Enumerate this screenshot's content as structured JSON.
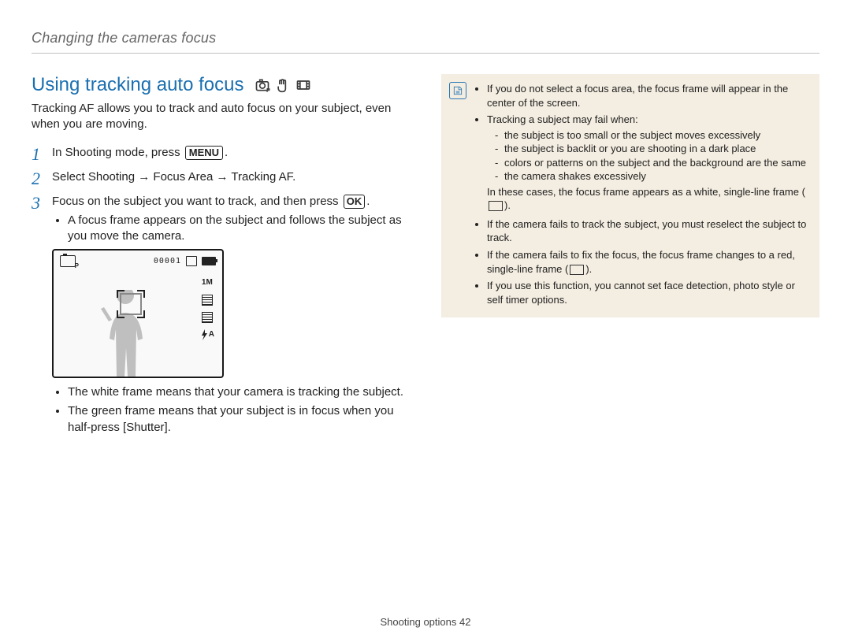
{
  "header": {
    "breadcrumb": "Changing the cameras focus"
  },
  "section": {
    "title": "Using tracking auto focus",
    "mode_icons": [
      "camera-p-icon",
      "hand-icon",
      "film-icon"
    ]
  },
  "intro": "Tracking AF allows you to track and auto focus on your subject, even when you are moving.",
  "steps": {
    "one": {
      "pre": "In Shooting mode, press ",
      "button": "MENU",
      "post": "."
    },
    "two": {
      "text": "Select Shooting → Focus Area → Tracking AF."
    },
    "three": {
      "pre": "Focus on the subject you want to track, and then press ",
      "button": "OK",
      "post": ".",
      "bullets": [
        "A focus frame appears on the subject and follows the subject as you move the camera.",
        "The white frame means that your camera is tracking the subject.",
        "The green frame means that your subject is in focus when you half-press [Shutter]."
      ]
    }
  },
  "screenshot": {
    "counter": "00001",
    "side_label_top": "1M",
    "flash_label": "A"
  },
  "note": {
    "items": [
      "If you do not select a focus area, the focus frame will appear in the center of the screen.",
      "Tracking a subject may fail when:"
    ],
    "fail_conditions": [
      "the subject is too small or the subject moves excessively",
      "the subject is backlit or you are shooting in a dark place",
      "colors or patterns on the subject and the background are the same",
      "the camera shakes excessively"
    ],
    "case_note_pre": "In these cases, the focus frame appears as a white, single-line frame (",
    "case_note_post": ").",
    "items_after": [
      "If the camera fails to track the subject, you must reselect the subject to track.",
      {
        "pre": "If the camera fails to fix the focus, the focus frame changes to a red, single-line frame (",
        "post": ")."
      },
      "If you use this function, you cannot set face detection, photo style or self timer options."
    ]
  },
  "footer": {
    "section": "Shooting options",
    "page": "42"
  }
}
